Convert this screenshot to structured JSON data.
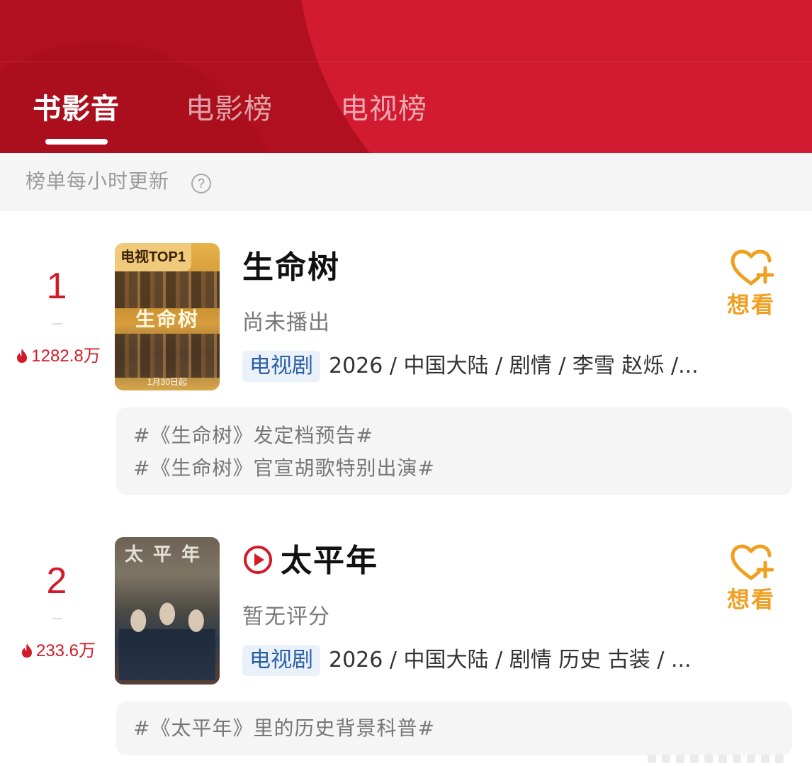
{
  "tabs": [
    {
      "label": "书影音",
      "active": true
    },
    {
      "label": "电影榜",
      "active": false
    },
    {
      "label": "电视榜",
      "active": false
    }
  ],
  "notice": {
    "text": "榜单每小时更新",
    "help_icon": "question-circle-icon"
  },
  "colors": {
    "header": "#c5142a",
    "rank": "#d21a28",
    "want": "#f0a021",
    "tag_bg": "#eaf1fb",
    "tag_text": "#2b5fa6"
  },
  "items": [
    {
      "rank": "1",
      "heat": "1282.8万",
      "poster": {
        "badge": "电视TOP1",
        "title": "生命树",
        "date": "1月30日起"
      },
      "title": "生命树",
      "status": "尚未播出",
      "type_tag": "电视剧",
      "meta": "2026 / 中国大陆 / 剧情 / 李雪 赵烁 /...",
      "want_label": "想看",
      "topics": [
        "#《生命树》发定档预告#",
        "#《生命树》官宣胡歌特别出演#"
      ]
    },
    {
      "rank": "2",
      "heat": "233.6万",
      "poster": {
        "title": "太平年"
      },
      "title": "太平年",
      "status": "暂无评分",
      "type_tag": "电视剧",
      "meta": "2026 / 中国大陆 / 剧情 历史 古装 / ...",
      "want_label": "想看",
      "topics": [
        "#《太平年》里的历史背景科普#"
      ]
    }
  ]
}
